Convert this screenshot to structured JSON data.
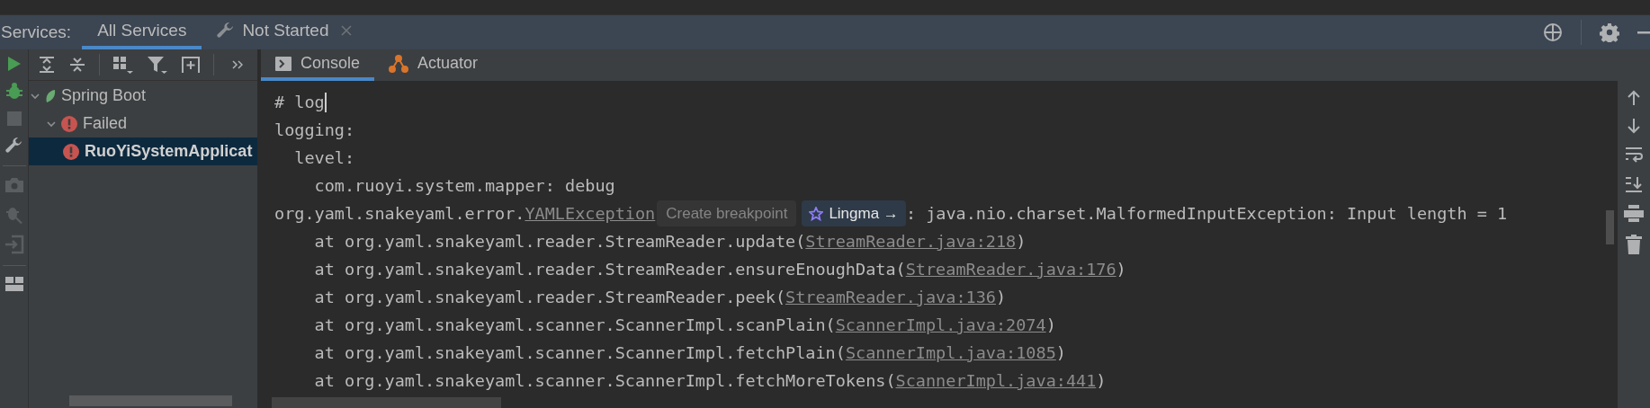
{
  "services_bar": {
    "label": "Services:",
    "tabs": [
      {
        "label": "All Services",
        "selected": true,
        "closable": false
      },
      {
        "label": "Not Started",
        "selected": false,
        "closable": true
      }
    ]
  },
  "tree": [
    {
      "label": "Spring Boot",
      "kind": "group",
      "expanded": true,
      "selected": false,
      "children": [
        {
          "label": "Failed",
          "kind": "failed",
          "expanded": true,
          "selected": false,
          "children": [
            {
              "label": "RuoYiSystemApplicat",
              "kind": "failed",
              "selected": true
            }
          ]
        }
      ]
    }
  ],
  "console_tabs": [
    {
      "label": "Console",
      "kind": "console",
      "selected": true
    },
    {
      "label": "Actuator",
      "kind": "actuator",
      "selected": false
    }
  ],
  "console_lines": [
    {
      "kind": "text",
      "text": "# log",
      "cursor": true
    },
    {
      "kind": "text",
      "text": "logging:",
      "cursor": false
    },
    {
      "kind": "text",
      "text": "  level:",
      "cursor": false
    },
    {
      "kind": "text",
      "text": "    com.ruoyi.system.mapper: debug",
      "cursor": false
    },
    {
      "kind": "exception",
      "prefix": "org.yaml.snakeyaml.error.",
      "link": "YAMLException",
      "hint": "Create breakpoint",
      "badge": "Lingma →",
      "message": ": java.nio.charset.MalformedInputException: Input length = 1"
    },
    {
      "kind": "stack",
      "text": "    at org.yaml.snakeyaml.reader.StreamReader.update(",
      "link": "StreamReader.java:218",
      "suffix": ")"
    },
    {
      "kind": "stack",
      "text": "    at org.yaml.snakeyaml.reader.StreamReader.ensureEnoughData(",
      "link": "StreamReader.java:176",
      "suffix": ")"
    },
    {
      "kind": "stack",
      "text": "    at org.yaml.snakeyaml.reader.StreamReader.peek(",
      "link": "StreamReader.java:136",
      "suffix": ")"
    },
    {
      "kind": "stack",
      "text": "    at org.yaml.snakeyaml.scanner.ScannerImpl.scanPlain(",
      "link": "ScannerImpl.java:2074",
      "suffix": ")"
    },
    {
      "kind": "stack",
      "text": "    at org.yaml.snakeyaml.scanner.ScannerImpl.fetchPlain(",
      "link": "ScannerImpl.java:1085",
      "suffix": ")"
    },
    {
      "kind": "stack",
      "text": "    at org.yaml.snakeyaml.scanner.ScannerImpl.fetchMoreTokens(",
      "link": "ScannerImpl.java:441",
      "suffix": ")"
    }
  ]
}
